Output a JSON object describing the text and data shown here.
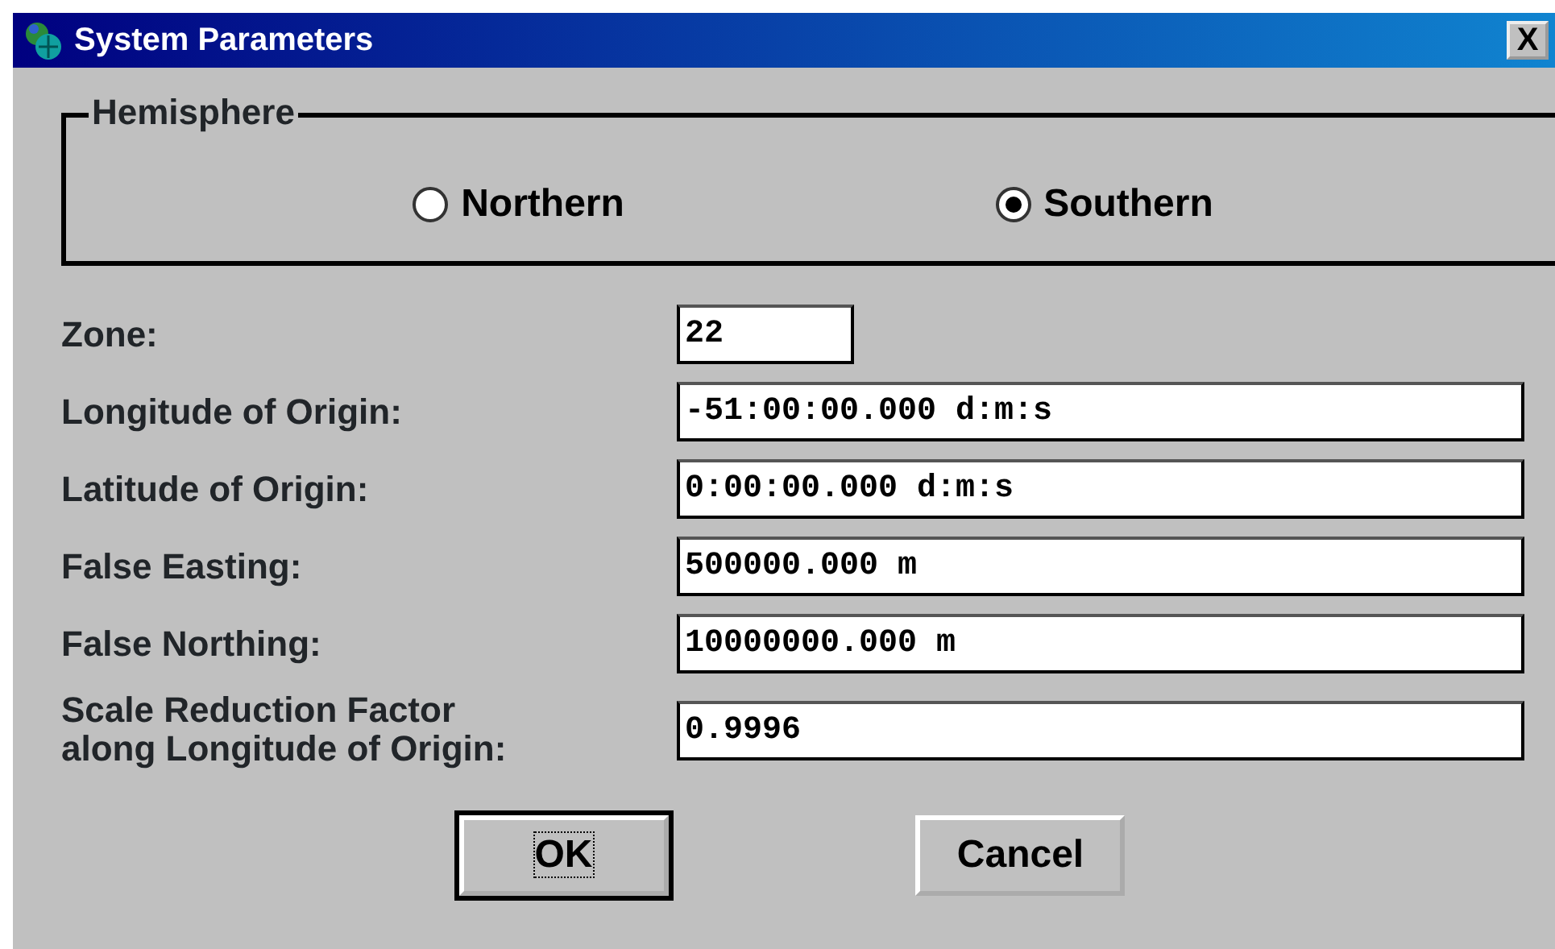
{
  "window": {
    "title": "System Parameters",
    "close": "X"
  },
  "hemisphere": {
    "label": "Hemisphere",
    "options": [
      {
        "label": "Northern",
        "selected": false
      },
      {
        "label": "Southern",
        "selected": true
      }
    ]
  },
  "fields": [
    {
      "label": "Zone:",
      "value": "22",
      "kind": "short"
    },
    {
      "label": "Longitude of Origin:",
      "value": "-51:00:00.000 d:m:s",
      "kind": "long"
    },
    {
      "label": "Latitude of Origin:",
      "value": "0:00:00.000 d:m:s",
      "kind": "long"
    },
    {
      "label": "False Easting:",
      "value": "500000.000 m",
      "kind": "long"
    },
    {
      "label": "False Northing:",
      "value": "10000000.000 m",
      "kind": "long"
    },
    {
      "label": "Scale Reduction Factor\nalong Longitude of Origin:",
      "value": "0.9996",
      "kind": "long"
    }
  ],
  "buttons": [
    {
      "label": "OK",
      "default": true
    },
    {
      "label": "Cancel",
      "default": false
    }
  ]
}
